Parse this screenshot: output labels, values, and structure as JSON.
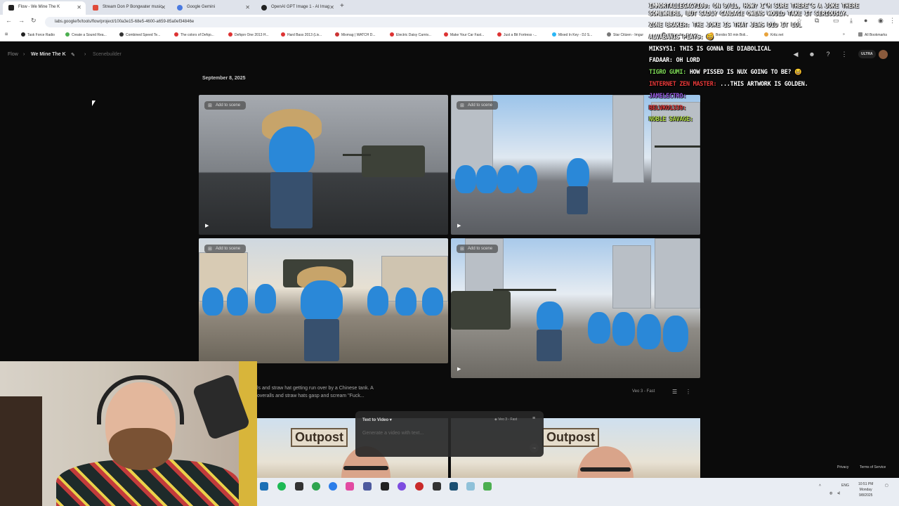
{
  "browser": {
    "tabs": [
      {
        "title": "Flow - We Mine The K",
        "color": "#222222"
      },
      {
        "title": "Stream Don P Bongwater music",
        "color": "#e04b3a"
      },
      {
        "title": "Google Gemini",
        "color": "#4a7ae0"
      },
      {
        "title": "OpenAI GPT Image 1 - AI Imag",
        "color": "#222222"
      }
    ],
    "new_tab": "+",
    "url": "labs.google/fx/tools/flow/project/100a3e15-68e5-4600-a659-85a0ef34846e",
    "bookmarks": [
      "Task Force Radio",
      "Create a Sound Rea...",
      "Combined Speed Te...",
      "The colors of Defqo...",
      "Defqon One 2013 H...",
      "Hard Bass 2013 (Liv...",
      "Mixmag | WATCH D...",
      "Electric Daisy Carniv...",
      "Make Your Car Fast...",
      "Just a Bit Fortress -...",
      "Mixed In Key - DJ S...",
      "Star Citizen - Imgur",
      "Wikipedia - Fidgets",
      "Borobo 50 min Boli...",
      "Kritz.net"
    ],
    "all_bookmarks": "All Bookmarks"
  },
  "app": {
    "breadcrumb": {
      "root": "Flow",
      "project": "We Mine The K",
      "view": "Scenebuilder"
    },
    "ultra_badge": "ULTRA",
    "date": "September 8, 2025",
    "add_to_scene": "Add to scene",
    "prompt_text": "ls and straw hat getting run over by a Chinese tank. A\noveralls and straw hats gasp and scream \"Fuck...",
    "model_label": "Veo 3 - Fast",
    "composer": {
      "mode": "Text to Video",
      "model": "Veo 3 - Fast",
      "placeholder": "Generate a video with text..."
    },
    "outpost_sign": "Outpost",
    "footer": {
      "privacy": "Privacy",
      "terms": "Terms of Service"
    }
  },
  "chat": [
    {
      "user": "IMMORTALLEGACY100:",
      "msg": " ON 9/11, HOW? I'M SURE THERE'S A JOKE THERE SOMEWHERE, BUT SADLY CANDACE OWENS WOULD TAKE IT SERIOUSLY.",
      "color": "#ffffff"
    },
    {
      "user": "ZONE BRAKER:",
      "msg": " THE JOKE IS THAT JEWS DID IT LOL",
      "color": "#ffffff"
    },
    {
      "user": "ALVABANIS PLAYS:",
      "msg": " 😃",
      "color": "#ffffff"
    },
    {
      "user": "MIKSY51:",
      "msg": " THIS IS GONNA BE DIABOLICAL",
      "color": "#ffffff"
    },
    {
      "user": "FADAAR:",
      "msg": " OH LORD",
      "color": "#ffffff"
    },
    {
      "user": "TIGRO GUMI:",
      "msg": " HOW PISSED IS NUX GOING TO BE? 😆",
      "color": "#7ed957"
    },
    {
      "user": "INTERNET ZEN MASTER:",
      "msg": " ...THIS ARTWORK IS GOLDEN.",
      "color": "#e83a3a"
    },
    {
      "user": "JAMELECTRO:",
      "msg": "",
      "color": "#9b5de5"
    },
    {
      "user": "BELVKO1339:",
      "msg": "",
      "color": "#e83a3a"
    },
    {
      "user": "NOBLE SAVAGE:",
      "msg": "",
      "color": "#b5e048"
    }
  ],
  "taskbar": {
    "lang": "ENG",
    "time": "10:51 PM",
    "day": "Monday",
    "date": "9/8/2025"
  }
}
